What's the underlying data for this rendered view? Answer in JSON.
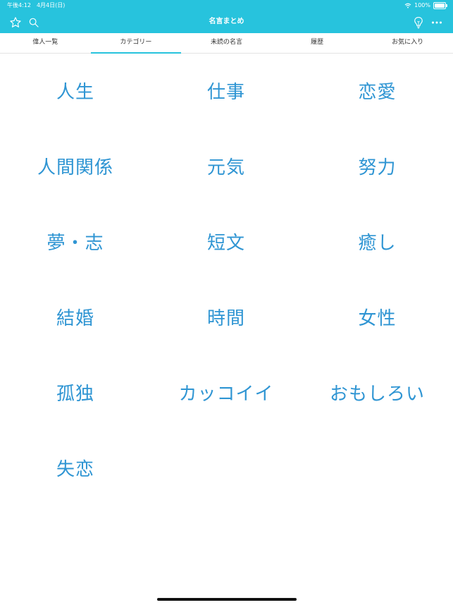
{
  "status_bar": {
    "time_date": "午後4:12　4月4日(日)",
    "battery": "100%"
  },
  "nav": {
    "title": "名言まとめ",
    "icons": [
      "star-icon",
      "search-icon",
      "lightbulb-icon",
      "more-icon"
    ]
  },
  "tabs": [
    {
      "label": "偉人一覧",
      "active": false
    },
    {
      "label": "カテゴリー",
      "active": true
    },
    {
      "label": "未読の名言",
      "active": false
    },
    {
      "label": "履歴",
      "active": false
    },
    {
      "label": "お気に入り",
      "active": false
    }
  ],
  "categories": [
    "人生",
    "仕事",
    "恋愛",
    "人間関係",
    "元気",
    "努力",
    "夢・志",
    "短文",
    "癒し",
    "結婚",
    "時間",
    "女性",
    "孤独",
    "カッコイイ",
    "おもしろい",
    "失恋"
  ],
  "colors": {
    "accent": "#27c3dd",
    "category_text": "#2f95d3"
  }
}
